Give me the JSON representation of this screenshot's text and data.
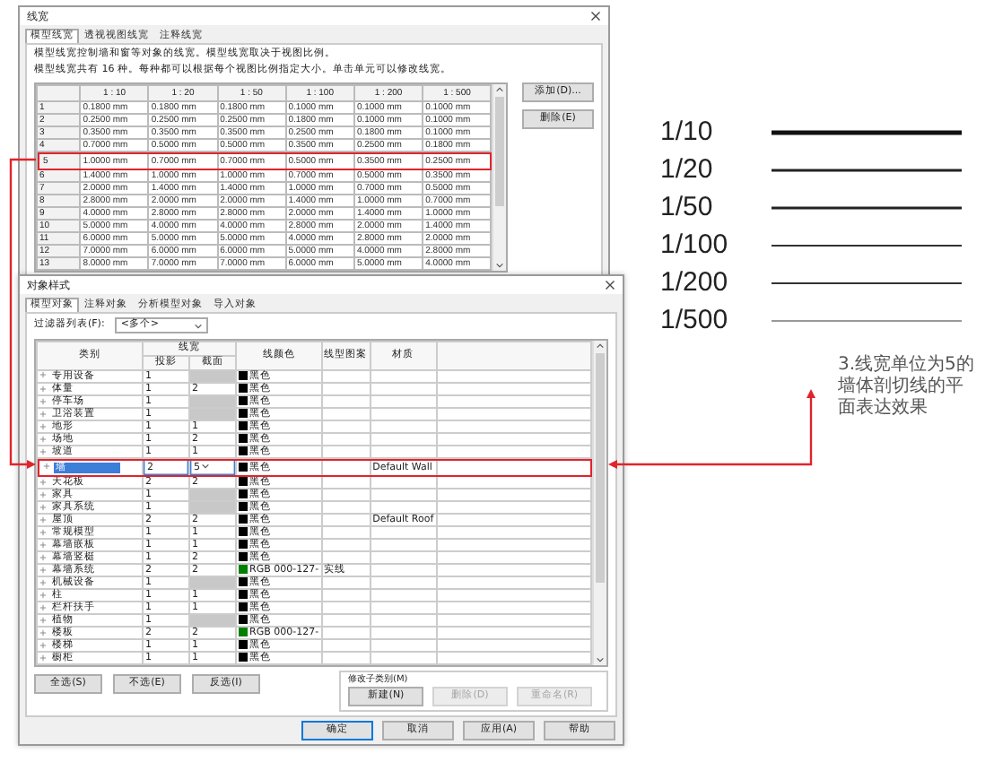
{
  "line_weights_dialog": {
    "title": "线宽",
    "tabs": [
      {
        "label": "模型线宽",
        "selected": true
      },
      {
        "label": "透视视图线宽",
        "selected": false
      },
      {
        "label": "注释线宽",
        "selected": false
      }
    ],
    "description": [
      "模型线宽控制墙和窗等对象的线宽。模型线宽取决于视图比例。",
      "模型线宽共有 16 种。每种都可以根据每个视图比例指定大小。单击单元可以修改线宽。"
    ],
    "columns": [
      "1 : 10",
      "1 : 20",
      "1 : 50",
      "1 : 100",
      "1 : 200",
      "1 : 500"
    ],
    "rows": [
      {
        "index": "1",
        "values": [
          "0.1800 mm",
          "0.1800 mm",
          "0.1800 mm",
          "0.1000 mm",
          "0.1000 mm",
          "0.1000 mm"
        ],
        "highlighted": false
      },
      {
        "index": "2",
        "values": [
          "0.2500 mm",
          "0.2500 mm",
          "0.2500 mm",
          "0.1800 mm",
          "0.1000 mm",
          "0.1000 mm"
        ],
        "highlighted": false
      },
      {
        "index": "3",
        "values": [
          "0.3500 mm",
          "0.3500 mm",
          "0.3500 mm",
          "0.2500 mm",
          "0.1800 mm",
          "0.1000 mm"
        ],
        "highlighted": false
      },
      {
        "index": "4",
        "values": [
          "0.7000 mm",
          "0.5000 mm",
          "0.5000 mm",
          "0.3500 mm",
          "0.2500 mm",
          "0.1800 mm"
        ],
        "highlighted": false
      },
      {
        "index": "5",
        "values": [
          "1.0000 mm",
          "0.7000 mm",
          "0.7000 mm",
          "0.5000 mm",
          "0.3500 mm",
          "0.2500 mm"
        ],
        "highlighted": true
      },
      {
        "index": "6",
        "values": [
          "1.4000 mm",
          "1.0000 mm",
          "1.0000 mm",
          "0.7000 mm",
          "0.5000 mm",
          "0.3500 mm"
        ],
        "highlighted": false
      },
      {
        "index": "7",
        "values": [
          "2.0000 mm",
          "1.4000 mm",
          "1.4000 mm",
          "1.0000 mm",
          "0.7000 mm",
          "0.5000 mm"
        ],
        "highlighted": false
      },
      {
        "index": "8",
        "values": [
          "2.8000 mm",
          "2.0000 mm",
          "2.0000 mm",
          "1.4000 mm",
          "1.0000 mm",
          "0.7000 mm"
        ],
        "highlighted": false
      },
      {
        "index": "9",
        "values": [
          "4.0000 mm",
          "2.8000 mm",
          "2.8000 mm",
          "2.0000 mm",
          "1.4000 mm",
          "1.0000 mm"
        ],
        "highlighted": false
      },
      {
        "index": "10",
        "values": [
          "5.0000 mm",
          "4.0000 mm",
          "4.0000 mm",
          "2.8000 mm",
          "2.0000 mm",
          "1.4000 mm"
        ],
        "highlighted": false
      },
      {
        "index": "11",
        "values": [
          "6.0000 mm",
          "5.0000 mm",
          "5.0000 mm",
          "4.0000 mm",
          "2.8000 mm",
          "2.0000 mm"
        ],
        "highlighted": false
      },
      {
        "index": "12",
        "values": [
          "7.0000 mm",
          "6.0000 mm",
          "6.0000 mm",
          "5.0000 mm",
          "4.0000 mm",
          "2.8000 mm"
        ],
        "highlighted": false
      },
      {
        "index": "13",
        "values": [
          "8.0000 mm",
          "7.0000 mm",
          "7.0000 mm",
          "6.0000 mm",
          "5.0000 mm",
          "4.0000 mm"
        ],
        "highlighted": false
      }
    ],
    "buttons": [
      "添加(D)...",
      "删除(E)"
    ]
  },
  "object_styles_dialog": {
    "title": "对象样式",
    "tabs": [
      {
        "label": "模型对象",
        "selected": true
      },
      {
        "label": "注释对象",
        "selected": false
      },
      {
        "label": "分析模型对象",
        "selected": false
      },
      {
        "label": "导入对象",
        "selected": false
      }
    ],
    "filter": {
      "label": "过滤器列表(F):",
      "value": "<多个>"
    },
    "columns": {
      "category": "类别",
      "line_weight": "线宽",
      "projection": "投影",
      "cut": "截面",
      "line_color": "线颜色",
      "line_pattern": "线型图案",
      "material": "材质"
    },
    "rows": [
      {
        "name": "专用设备",
        "projection": "1",
        "color_name": "黑色",
        "color": "#000000",
        "selected": false,
        "highlighted": false
      },
      {
        "name": "体量",
        "projection": "1",
        "cut": "2",
        "color_name": "黑色",
        "color": "#000000",
        "selected": false,
        "highlighted": false
      },
      {
        "name": "停车场",
        "projection": "1",
        "color_name": "黑色",
        "color": "#000000",
        "selected": false,
        "highlighted": false
      },
      {
        "name": "卫浴装置",
        "projection": "1",
        "color_name": "黑色",
        "color": "#000000",
        "selected": false,
        "highlighted": false
      },
      {
        "name": "地形",
        "projection": "1",
        "cut": "1",
        "color_name": "黑色",
        "color": "#000000",
        "selected": false,
        "highlighted": false
      },
      {
        "name": "场地",
        "projection": "1",
        "cut": "2",
        "color_name": "黑色",
        "color": "#000000",
        "selected": false,
        "highlighted": false
      },
      {
        "name": "坡道",
        "projection": "1",
        "cut": "1",
        "color_name": "黑色",
        "color": "#000000",
        "selected": false,
        "highlighted": false
      },
      {
        "name": "墙",
        "projection": "2",
        "cut": "5",
        "color_name": "黑色",
        "color": "#000000",
        "material": "Default Wall",
        "selected": true,
        "highlighted": true
      },
      {
        "name": "天花板",
        "projection": "2",
        "cut": "2",
        "color_name": "黑色",
        "color": "#000000",
        "selected": false,
        "highlighted": false
      },
      {
        "name": "家具",
        "projection": "1",
        "color_name": "黑色",
        "color": "#000000",
        "selected": false,
        "highlighted": false
      },
      {
        "name": "家具系统",
        "projection": "1",
        "color_name": "黑色",
        "color": "#000000",
        "selected": false,
        "highlighted": false
      },
      {
        "name": "屋顶",
        "projection": "2",
        "cut": "2",
        "color_name": "黑色",
        "color": "#000000",
        "material": "Default Roof",
        "selected": false,
        "highlighted": false
      },
      {
        "name": "常规模型",
        "projection": "1",
        "cut": "1",
        "color_name": "黑色",
        "color": "#000000",
        "selected": false,
        "highlighted": false
      },
      {
        "name": "幕墙嵌板",
        "projection": "1",
        "cut": "1",
        "color_name": "黑色",
        "color": "#000000",
        "selected": false,
        "highlighted": false
      },
      {
        "name": "幕墙竖梃",
        "projection": "1",
        "cut": "2",
        "color_name": "黑色",
        "color": "#000000",
        "selected": false,
        "highlighted": false
      },
      {
        "name": "幕墙系统",
        "projection": "2",
        "cut": "2",
        "color_name": "RGB 000-127-",
        "color": "#007f00",
        "pattern": "实线",
        "selected": false,
        "highlighted": false
      },
      {
        "name": "机械设备",
        "projection": "1",
        "color_name": "黑色",
        "color": "#000000",
        "selected": false,
        "highlighted": false
      },
      {
        "name": "柱",
        "projection": "1",
        "cut": "1",
        "color_name": "黑色",
        "color": "#000000",
        "selected": false,
        "highlighted": false
      },
      {
        "name": "栏杆扶手",
        "projection": "1",
        "cut": "1",
        "color_name": "黑色",
        "color": "#000000",
        "selected": false,
        "highlighted": false
      },
      {
        "name": "植物",
        "projection": "1",
        "color_name": "黑色",
        "color": "#000000",
        "selected": false,
        "highlighted": false
      },
      {
        "name": "楼板",
        "projection": "2",
        "cut": "2",
        "color_name": "RGB 000-127-",
        "color": "#007f00",
        "selected": false,
        "highlighted": false
      },
      {
        "name": "楼梯",
        "projection": "1",
        "cut": "1",
        "color_name": "黑色",
        "color": "#000000",
        "selected": false,
        "highlighted": false
      },
      {
        "name": "橱柜",
        "projection": "1",
        "cut": "1",
        "color_name": "黑色",
        "color": "#000000",
        "selected": false,
        "highlighted": false
      }
    ],
    "select_buttons": [
      "全选(S)",
      "不选(E)",
      "反选(I)"
    ],
    "subcategories": {
      "label": "修改子类别(M)",
      "buttons": [
        {
          "label": "新建(N)",
          "disabled": false
        },
        {
          "label": "删除(D)",
          "disabled": true
        },
        {
          "label": "重命名(R)",
          "disabled": true
        }
      ]
    },
    "footer_buttons": [
      {
        "label": "确定",
        "default": true
      },
      {
        "label": "取消",
        "default": false
      },
      {
        "label": "应用(A)",
        "default": false
      },
      {
        "label": "帮助",
        "default": false
      }
    ]
  },
  "scale_legend": [
    {
      "label": "1/10",
      "kind": "heavy"
    },
    {
      "label": "1/20",
      "kind": "medium"
    },
    {
      "label": "1/50",
      "kind": "medium"
    },
    {
      "label": "1/100",
      "kind": "thin"
    },
    {
      "label": "1/200",
      "kind": "thin"
    },
    {
      "label": "1/500",
      "kind": "fine"
    }
  ],
  "annotation": "3.线宽单位为5的墙体剖切线的平面表达效果"
}
